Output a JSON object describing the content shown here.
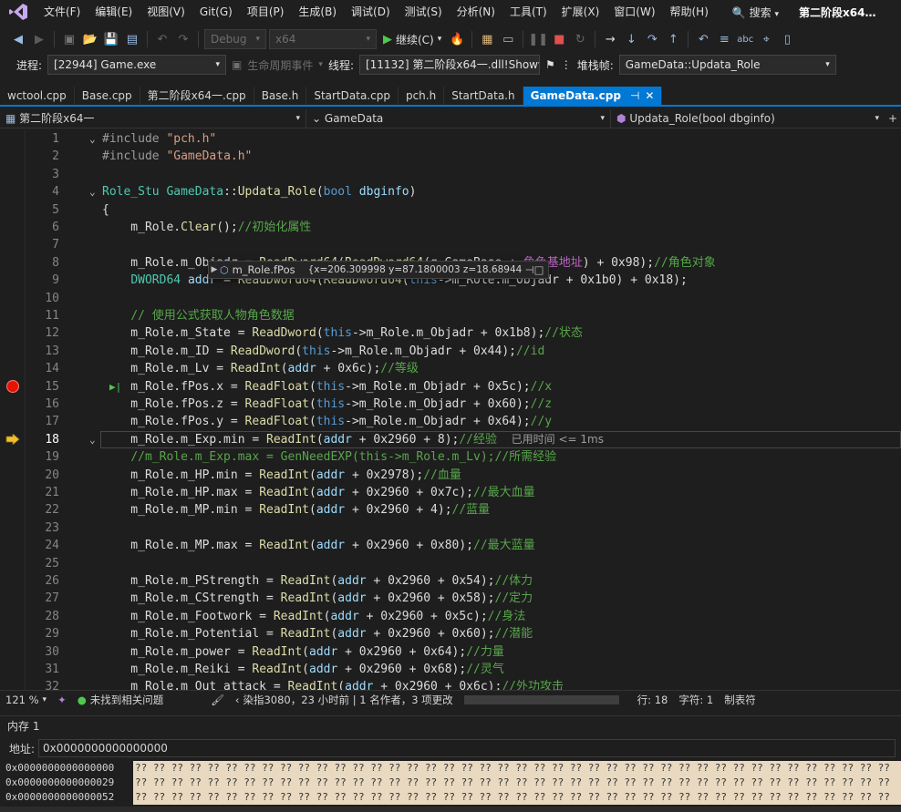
{
  "menu": {
    "items": [
      "文件(F)",
      "编辑(E)",
      "视图(V)",
      "Git(G)",
      "项目(P)",
      "生成(B)",
      "调试(D)",
      "测试(S)",
      "分析(N)",
      "工具(T)",
      "扩展(X)",
      "窗口(W)",
      "帮助(H)"
    ],
    "search_label": "搜索",
    "window_title": "第二阶段x64…"
  },
  "toolbar": {
    "config": "Debug",
    "platform": "x64",
    "continue_label": "继续(C)"
  },
  "debug_location": {
    "process_label": "进程:",
    "process_value": "[22944] Game.exe",
    "lifecycle_label": "生命周期事件",
    "thread_label": "线程:",
    "thread_value": "[11132] 第二阶段x64一.dll!Show",
    "stackframe_label": "堆栈帧:",
    "stackframe_value": "GameData::Updata_Role"
  },
  "tabs": [
    {
      "label": "wctool.cpp",
      "active": false
    },
    {
      "label": "Base.cpp",
      "active": false
    },
    {
      "label": "第二阶段x64一.cpp",
      "active": false
    },
    {
      "label": "Base.h",
      "active": false
    },
    {
      "label": "StartData.cpp",
      "active": false
    },
    {
      "label": "pch.h",
      "active": false
    },
    {
      "label": "StartData.h",
      "active": false
    },
    {
      "label": "GameData.cpp",
      "active": true
    }
  ],
  "navbar": {
    "project": "第二阶段x64一",
    "scope": "GameData",
    "member": "Updata_Role(bool dbginfo)"
  },
  "code": {
    "lines": [
      {
        "n": "1",
        "html": "<span class='inc'>#include</span> <span class='str'>\"pch.h\"</span>"
      },
      {
        "n": "2",
        "html": "<span class='inc'>#include</span> <span class='str'>\"GameData.h\"</span>"
      },
      {
        "n": "3",
        "html": ""
      },
      {
        "n": "4",
        "html": "<span class='ty'>Role_Stu</span> <span class='ty'>GameData</span>::<span class='fn'>Updata_Role</span>(<span class='kw'>bool</span> <span class='prm'>dbginfo</span>)"
      },
      {
        "n": "5",
        "html": "{"
      },
      {
        "n": "6",
        "html": "    m_Role.<span class='fn'>Clear</span>();<span class='cm'>//初始化属性</span>"
      },
      {
        "n": "7",
        "html": ""
      },
      {
        "n": "8",
        "html": "    m_Role.m_Objadr = <span class='fn'>ReadDword64</span>(<span class='fn'>ReadDword64</span>(g_GameBase + <span class='mac'>角色基地址</span>) + 0x98);<span class='cm'>//角色对象</span>"
      },
      {
        "n": "9",
        "html": "    <span class='ty'>DWORD64</span> <span class='prm'>addr</span> = <span class='fn'>ReadDword64</span>(<span class='fn'>ReadDword64</span>(<span class='kw'>this</span>-&gt;m_Role.m_Objadr + 0x1b0) + 0x18);"
      },
      {
        "n": "10",
        "html": ""
      },
      {
        "n": "11",
        "html": "    <span class='cm'>// 使用公式获取人物角色数据</span>"
      },
      {
        "n": "12",
        "html": "    m_Role.m_State = <span class='fn'>ReadDword</span>(<span class='kw'>this</span>-&gt;m_Role.m_Objadr + 0x1b8);<span class='cm'>//状态</span>"
      },
      {
        "n": "13",
        "html": "    m_Role.m_ID = <span class='fn'>ReadDword</span>(<span class='kw'>this</span>-&gt;m_Role.m_Objadr + 0x44);<span class='cm'>//id</span>"
      },
      {
        "n": "14",
        "html": "    m_Role.m_Lv = <span class='fn'>ReadInt</span>(<span class='prm'>addr</span> + 0x6c);<span class='cm'>//等级</span>"
      },
      {
        "n": "15",
        "html": "    m_Role.fPos.x = <span class='fn'>ReadFloat</span>(<span class='kw'>this</span>-&gt;m_Role.m_Objadr + 0x5c);<span class='cm'>//x</span>"
      },
      {
        "n": "16",
        "html": "    m_Role.fPos.z = <span class='fn'>ReadFloat</span>(<span class='kw'>this</span>-&gt;m_Role.m_Objadr + 0x60);<span class='cm'>//z</span>"
      },
      {
        "n": "17",
        "html": "    m_Role.fPos.y = <span class='fn'>ReadFloat</span>(<span class='kw'>this</span>-&gt;m_Role.m_Objadr + 0x64);<span class='cm'>//y</span>"
      },
      {
        "n": "18",
        "html": "    m_Role.m_Exp.min = <span class='fn'>ReadInt</span>(<span class='prm'>addr</span> + 0x2960 + 8);<span class='cm'>//经验</span>  <span class='hint'>已用时间 &lt;= 1ms</span>"
      },
      {
        "n": "19",
        "html": "    <span class='cm'>//m_Role.m_Exp.max = GenNeedEXP(this-&gt;m_Role.m_Lv);//所需经验</span>"
      },
      {
        "n": "20",
        "html": "    m_Role.m_HP.min = <span class='fn'>ReadInt</span>(<span class='prm'>addr</span> + 0x2978);<span class='cm'>//血量</span>"
      },
      {
        "n": "21",
        "html": "    m_Role.m_HP.max = <span class='fn'>ReadInt</span>(<span class='prm'>addr</span> + 0x2960 + 0x7c);<span class='cm'>//最大血量</span>"
      },
      {
        "n": "22",
        "html": "    m_Role.m_MP.min = <span class='fn'>ReadInt</span>(<span class='prm'>addr</span> + 0x2960 + 4);<span class='cm'>//蓝量</span>"
      },
      {
        "n": "23",
        "html": ""
      },
      {
        "n": "24",
        "html": "    m_Role.m_MP.max = <span class='fn'>ReadInt</span>(<span class='prm'>addr</span> + 0x2960 + 0x80);<span class='cm'>//最大蓝量</span>"
      },
      {
        "n": "25",
        "html": ""
      },
      {
        "n": "26",
        "html": "    m_Role.m_PStrength = <span class='fn'>ReadInt</span>(<span class='prm'>addr</span> + 0x2960 + 0x54);<span class='cm'>//体力</span>"
      },
      {
        "n": "27",
        "html": "    m_Role.m_CStrength = <span class='fn'>ReadInt</span>(<span class='prm'>addr</span> + 0x2960 + 0x58);<span class='cm'>//定力</span>"
      },
      {
        "n": "28",
        "html": "    m_Role.m_Footwork = <span class='fn'>ReadInt</span>(<span class='prm'>addr</span> + 0x2960 + 0x5c);<span class='cm'>//身法</span>"
      },
      {
        "n": "29",
        "html": "    m_Role.m_Potential = <span class='fn'>ReadInt</span>(<span class='prm'>addr</span> + 0x2960 + 0x60);<span class='cm'>//潜能</span>"
      },
      {
        "n": "30",
        "html": "    m_Role.m_power = <span class='fn'>ReadInt</span>(<span class='prm'>addr</span> + 0x2960 + 0x64);<span class='cm'>//力量</span>"
      },
      {
        "n": "31",
        "html": "    m_Role.m_Reiki = <span class='fn'>ReadInt</span>(<span class='prm'>addr</span> + 0x2960 + 0x68);<span class='cm'>//灵气</span>"
      },
      {
        "n": "32",
        "html": "    m_Role.m_Out_attack = <span class='fn'>ReadInt</span>(<span class='prm'>addr</span> + 0x2960 + 0x6c);<span class='cm'>//外功攻击</span>"
      }
    ],
    "breakpoint_line": "15",
    "current_line": "18"
  },
  "datatip": {
    "name": "m_Role.fPos",
    "value": "{x=206.309998 y=87.1800003 z=18.6894436 ...}"
  },
  "editor_status": {
    "zoom": "121 %",
    "issues": "未找到相关问题",
    "codelens": "染指3080，23 小时前 | 1 名作者，3 项更改",
    "line": "行: 18",
    "col": "字符: 1",
    "tabs": "制表符"
  },
  "memory": {
    "title": "内存 1",
    "address_label": "地址:",
    "address_value": "0x0000000000000000",
    "rows": [
      {
        "addr": "0x0000000000000000",
        "bytes": "?? ?? ?? ?? ?? ?? ?? ?? ?? ?? ?? ?? ?? ?? ?? ?? ?? ?? ?? ?? ?? ?? ?? ?? ?? ?? ?? ?? ?? ?? ?? ?? ?? ?? ?? ?? ?? ?? ?? ?? ?? ??"
      },
      {
        "addr": "0x0000000000000029",
        "bytes": "?? ?? ?? ?? ?? ?? ?? ?? ?? ?? ?? ?? ?? ?? ?? ?? ?? ?? ?? ?? ?? ?? ?? ?? ?? ?? ?? ?? ?? ?? ?? ?? ?? ?? ?? ?? ?? ?? ?? ?? ?? ??"
      },
      {
        "addr": "0x0000000000000052",
        "bytes": "?? ?? ?? ?? ?? ?? ?? ?? ?? ?? ?? ?? ?? ?? ?? ?? ?? ?? ?? ?? ?? ?? ?? ?? ?? ?? ?? ?? ?? ?? ?? ?? ?? ?? ?? ?? ?? ?? ?? ?? ?? ??"
      }
    ]
  },
  "colors": {
    "accent": "#0078d4",
    "breakpoint": "#e51400",
    "current_arrow": "#f0c030"
  }
}
